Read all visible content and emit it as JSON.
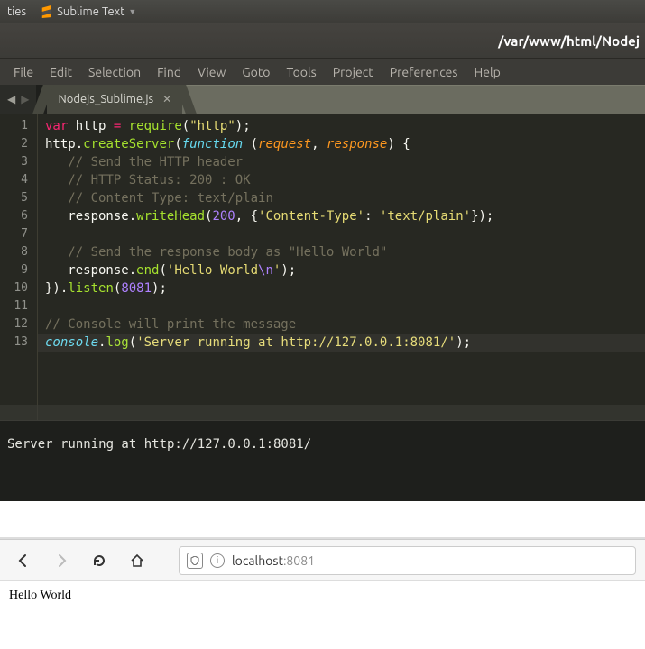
{
  "top_panel": {
    "left_partial": "ties",
    "app_name": "Sublime Text"
  },
  "window": {
    "title_partial": "/var/www/html/Nodej"
  },
  "menubar": [
    "File",
    "Edit",
    "Selection",
    "Find",
    "View",
    "Goto",
    "Tools",
    "Project",
    "Preferences",
    "Help"
  ],
  "tab": {
    "filename": "Nodejs_Sublime.js",
    "close": "✕"
  },
  "code": {
    "line_count": 13,
    "lines": [
      {
        "n": 1,
        "tokens": [
          [
            "kw",
            "var"
          ],
          [
            "plain",
            " http "
          ],
          [
            "kw",
            "="
          ],
          [
            "plain",
            " "
          ],
          [
            "fn",
            "require"
          ],
          [
            "plain",
            "("
          ],
          [
            "str",
            "\"http\""
          ],
          [
            "plain",
            ");"
          ]
        ]
      },
      {
        "n": 2,
        "tokens": [
          [
            "plain",
            "http."
          ],
          [
            "fn",
            "createServer"
          ],
          [
            "plain",
            "("
          ],
          [
            "type",
            "function"
          ],
          [
            "plain",
            " ("
          ],
          [
            "param",
            "request"
          ],
          [
            "plain",
            ", "
          ],
          [
            "param",
            "response"
          ],
          [
            "plain",
            ") {"
          ]
        ]
      },
      {
        "n": 3,
        "tokens": [
          [
            "plain",
            "   "
          ],
          [
            "com",
            "// Send the HTTP header"
          ]
        ]
      },
      {
        "n": 4,
        "tokens": [
          [
            "plain",
            "   "
          ],
          [
            "com",
            "// HTTP Status: 200 : OK"
          ]
        ]
      },
      {
        "n": 5,
        "tokens": [
          [
            "plain",
            "   "
          ],
          [
            "com",
            "// Content Type: text/plain"
          ]
        ]
      },
      {
        "n": 6,
        "tokens": [
          [
            "plain",
            "   response."
          ],
          [
            "fn",
            "writeHead"
          ],
          [
            "plain",
            "("
          ],
          [
            "num",
            "200"
          ],
          [
            "plain",
            ", {"
          ],
          [
            "str",
            "'Content-Type'"
          ],
          [
            "plain",
            ": "
          ],
          [
            "str",
            "'text/plain'"
          ],
          [
            "plain",
            "});"
          ]
        ]
      },
      {
        "n": 7,
        "tokens": [
          [
            "plain",
            " "
          ]
        ]
      },
      {
        "n": 8,
        "tokens": [
          [
            "plain",
            "   "
          ],
          [
            "com",
            "// Send the response body as \"Hello World\""
          ]
        ]
      },
      {
        "n": 9,
        "tokens": [
          [
            "plain",
            "   response."
          ],
          [
            "fn",
            "end"
          ],
          [
            "plain",
            "("
          ],
          [
            "str",
            "'Hello World"
          ],
          [
            "esc",
            "\\n"
          ],
          [
            "str",
            "'"
          ],
          [
            "plain",
            ");"
          ]
        ]
      },
      {
        "n": 10,
        "tokens": [
          [
            "plain",
            "})."
          ],
          [
            "fn",
            "listen"
          ],
          [
            "plain",
            "("
          ],
          [
            "num",
            "8081"
          ],
          [
            "plain",
            ");"
          ]
        ]
      },
      {
        "n": 11,
        "tokens": [
          [
            "plain",
            " "
          ]
        ]
      },
      {
        "n": 12,
        "tokens": [
          [
            "com",
            "// Console will print the message"
          ]
        ]
      },
      {
        "n": 13,
        "tokens": [
          [
            "type",
            "console"
          ],
          [
            "plain",
            "."
          ],
          [
            "fn",
            "log"
          ],
          [
            "plain",
            "("
          ],
          [
            "str",
            "'Server running at http://127.0.0.1:8081/'"
          ],
          [
            "plain",
            ");"
          ]
        ]
      }
    ]
  },
  "console_output": "Server running at http://127.0.0.1:8081/",
  "browser": {
    "host": "localhost",
    "port": ":8081",
    "body": "Hello World"
  }
}
